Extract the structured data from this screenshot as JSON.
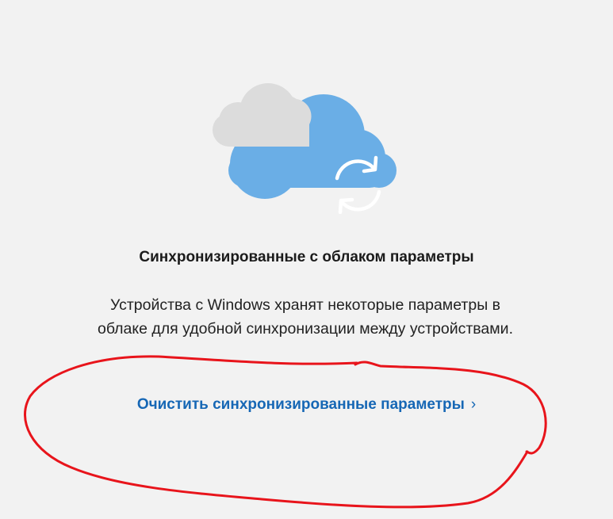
{
  "illustration": {
    "icon_name": "cloud-sync-icon",
    "colors": {
      "gray_cloud": "#dcdcdc",
      "blue_cloud": "#6aaee6",
      "sync_arrows": "#ffffff"
    }
  },
  "section": {
    "title": "Синхронизированные с облаком параметры",
    "description_line1": "Устройства с Windows хранят некоторые параметры в",
    "description_line2": "облаке для удобной синхронизации между устройствами."
  },
  "action": {
    "clear_label": "Очистить синхронизированные параметры",
    "chevron": "›",
    "color": "#1667b5"
  },
  "annotation": {
    "stroke_color": "#e8141b",
    "shape": "hand-drawn-ellipse"
  }
}
